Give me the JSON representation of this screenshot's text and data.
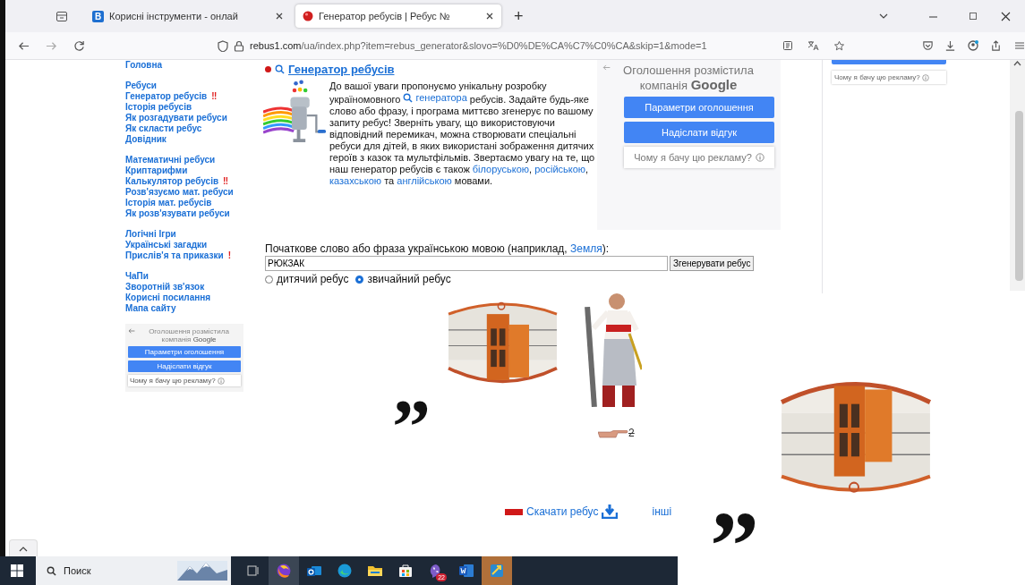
{
  "browser": {
    "tabs": [
      {
        "title": "Корисні інструменти - онлай",
        "icon_text": "B",
        "selected": false
      },
      {
        "title": "Генератор ребусів | Ребус №",
        "selected": true
      }
    ],
    "new_tab": "+",
    "url": {
      "domain": "rebus1.com",
      "path": "/ua/index.php?item=rebus_generator&slovo=%D0%DE%CA%C7%C0%CA&skip=1&mode=1"
    }
  },
  "sidebar": {
    "groups": [
      {
        "items": [
          {
            "label": "Головна"
          }
        ]
      },
      {
        "items": [
          {
            "label": "Ребуси"
          },
          {
            "label": "Генератор ребусів",
            "badge": "‼"
          },
          {
            "label": "Історія ребусів"
          },
          {
            "label": "Як розгадувати ребуси"
          },
          {
            "label": "Як скласти ребус"
          },
          {
            "label": "Довідник"
          }
        ]
      },
      {
        "items": [
          {
            "label": "Математичні ребуси"
          },
          {
            "label": "Криптарифми"
          },
          {
            "label": "Калькулятор ребусів",
            "badge": "‼"
          },
          {
            "label": "Розв'язуємо мат. ребуси"
          },
          {
            "label": "Історія мат. ребусів"
          },
          {
            "label": "Як розв'язувати ребуси"
          }
        ]
      },
      {
        "items": [
          {
            "label": "Логічні Ігри"
          },
          {
            "label": "Українські загадки"
          },
          {
            "label": "Прислів'я та приказки",
            "badge": "!"
          }
        ]
      },
      {
        "items": [
          {
            "label": "ЧаПи"
          },
          {
            "label": "Зворотній зв'язок"
          },
          {
            "label": "Корисні посилання"
          },
          {
            "label": "Мапа сайту"
          }
        ]
      }
    ]
  },
  "sidebar_ad": {
    "title": "Оголошення розмістила компанія **Google**",
    "buttons": [
      "Параметри оголошення",
      "Надіслати відгук"
    ],
    "why": "Чому я бачу цю рекламу?",
    "info_icon": true
  },
  "article": {
    "heading": "Генератор ребусів",
    "intro": [
      {
        "text": "До вашої уваги пропонуємо унікальну розробку україномовного "
      },
      {
        "text": "генератора",
        "link": true,
        "search_icon": true
      },
      {
        "text": " ребусів. Задайте будь-яке слово або фразу, і програма миттєво згенерує по вашому запиту ребус! Зверніть увагу, що використовуючи відповідний перемикач, можна створювати спеціальні ребуси для дітей, в яких використані зображення дитячих героїв з казок та мультфільмів. Звертаємо увагу на те, що наш генератор ребусів є також "
      },
      {
        "text": "білоруською",
        "link": true
      },
      {
        "text": ", "
      },
      {
        "text": "російською",
        "link": true
      },
      {
        "text": ", "
      },
      {
        "text": "казахською",
        "link": true
      },
      {
        "text": " та "
      },
      {
        "text": "англійською",
        "link": true
      },
      {
        "text": " мовами."
      }
    ],
    "form": {
      "label": [
        {
          "text": "Початкове слово або фраза українською мовою (наприклад, "
        },
        {
          "text": "Земля",
          "link": true
        },
        {
          "text": "):"
        }
      ],
      "value": "РЮКЗАК",
      "button": "Згенерувати ребус",
      "options": [
        {
          "label": "дитячий ребус",
          "selected": false
        },
        {
          "label": "звичайний ребус",
          "selected": true
        }
      ]
    }
  },
  "ad": {
    "title": "Оголошення розмістила компанія **Google**",
    "buttons": [
      "Параметри оголошення",
      "Надіслати відгук"
    ],
    "why": "Чому я бачу цю рекламу?",
    "info_icon": true
  },
  "side_ad": {
    "why": "Чому я бачу цю рекламу?",
    "info_icon": true
  },
  "rebus": {
    "quote": "”",
    "hint": "2"
  },
  "download": {
    "link": "Скачати ребус",
    "other": "інші"
  },
  "taskbar": {
    "placeholder": "Поиск",
    "badge": "22"
  },
  "overlay": {
    "quote": "”"
  }
}
